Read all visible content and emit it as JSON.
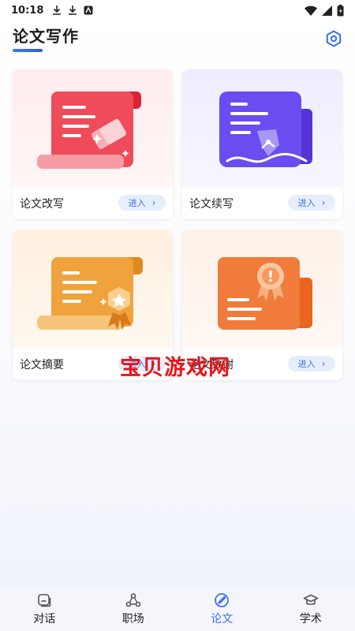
{
  "status_bar": {
    "time": "10:18"
  },
  "header": {
    "title": "论文写作"
  },
  "cards": [
    {
      "label": "论文改写",
      "button": "进入",
      "accent": "#ef4b5a"
    },
    {
      "label": "论文续写",
      "button": "进入",
      "accent": "#6a4cf0"
    },
    {
      "label": "论文摘要",
      "button": "进入",
      "accent": "#f0a33c"
    },
    {
      "label": "论文致谢",
      "button": "进入",
      "accent": "#f07b3a"
    }
  ],
  "watermark": "宝贝游戏网",
  "nav": [
    {
      "label": "对话",
      "icon": "chat-icon"
    },
    {
      "label": "职场",
      "icon": "network-icon"
    },
    {
      "label": "论文",
      "icon": "pen-icon"
    },
    {
      "label": "学术",
      "icon": "graduation-cap-icon"
    }
  ],
  "colors": {
    "primary": "#3a6ee8",
    "watermark": "#e8151b"
  }
}
